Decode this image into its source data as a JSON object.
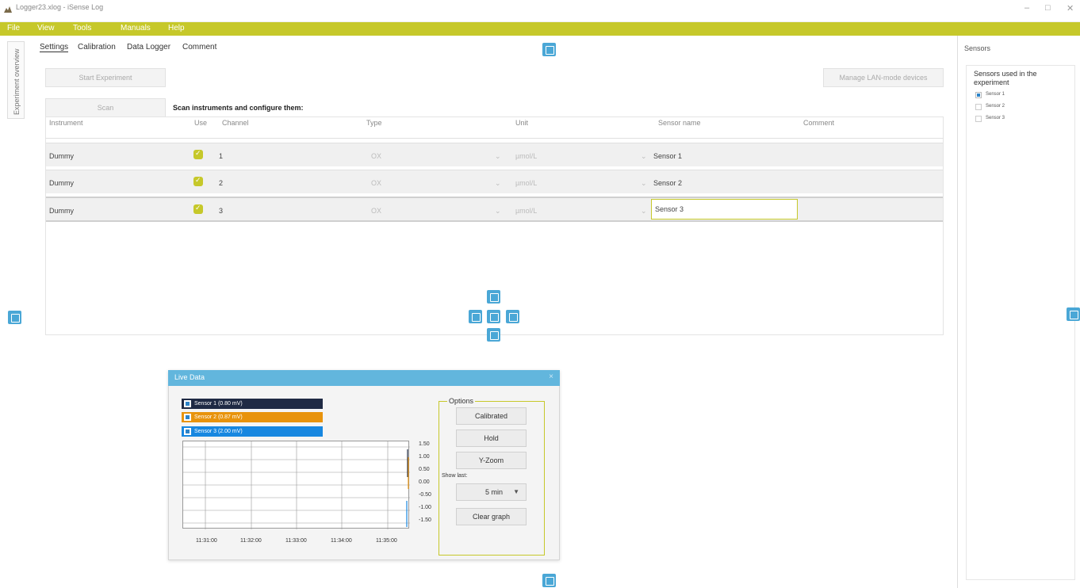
{
  "window": {
    "title": "Logger23.xlog - iSense Log",
    "controls": [
      "–",
      "□",
      "✕"
    ]
  },
  "menu": [
    "File",
    "View",
    "Tools",
    "Manuals",
    "Help"
  ],
  "left_tab": "Experiment overview",
  "tabs": [
    "Settings",
    "Calibration",
    "Data Logger",
    "Comment"
  ],
  "buttons": {
    "start_experiment": "Start Experiment",
    "scan": "Scan",
    "manage_lan": "Manage LAN-mode devices"
  },
  "scan_heading": "Scan instruments and configure them:",
  "table": {
    "headers": [
      "Instrument",
      "Use",
      "Channel",
      "Type",
      "Unit",
      "Sensor name",
      "Comment"
    ],
    "rows": [
      {
        "instrument": "Dummy",
        "channel": "1",
        "type": "OX",
        "unit": "µmol/L",
        "sensor_name": "Sensor 1",
        "comment": ""
      },
      {
        "instrument": "Dummy",
        "channel": "2",
        "type": "OX",
        "unit": "µmol/L",
        "sensor_name": "Sensor 2",
        "comment": ""
      },
      {
        "instrument": "Dummy",
        "channel": "3",
        "type": "OX",
        "unit": "µmol/L",
        "sensor_name": "Sensor 3",
        "comment": ""
      }
    ]
  },
  "sensors_panel": {
    "title": "Sensors",
    "subtitle": "Sensors used in the experiment",
    "items": [
      {
        "label": "Sensor 1",
        "checked": true
      },
      {
        "label": "Sensor 2",
        "checked": false
      },
      {
        "label": "Sensor 3",
        "checked": false
      }
    ]
  },
  "live_data": {
    "title": "Live Data",
    "legend": [
      {
        "label": "Sensor 1 (0.80 mV)",
        "color": "#1f2a44"
      },
      {
        "label": "Sensor 2 (0.87 mV)",
        "color": "#e8930c"
      },
      {
        "label": "Sensor 3 (2.00 mV)",
        "color": "#1787e0"
      }
    ],
    "y_ticks": [
      "1.50",
      "1.00",
      "0.50",
      "0.00",
      "-0.50",
      "-1.00",
      "-1.50"
    ],
    "x_ticks": [
      "11:31:00",
      "11:32:00",
      "11:33:00",
      "11:34:00",
      "11:35:00"
    ],
    "options_label": "Options",
    "calibrated": "Calibrated",
    "hold": "Hold",
    "y_zoom": "Y-Zoom",
    "show_last_label": "Show last:",
    "show_last_value": "5 min",
    "clear_graph": "Clear graph"
  },
  "colors": {
    "accent": "#c6c82a",
    "panel_blue": "#4aa7d6",
    "live_title": "#62b6dd"
  }
}
